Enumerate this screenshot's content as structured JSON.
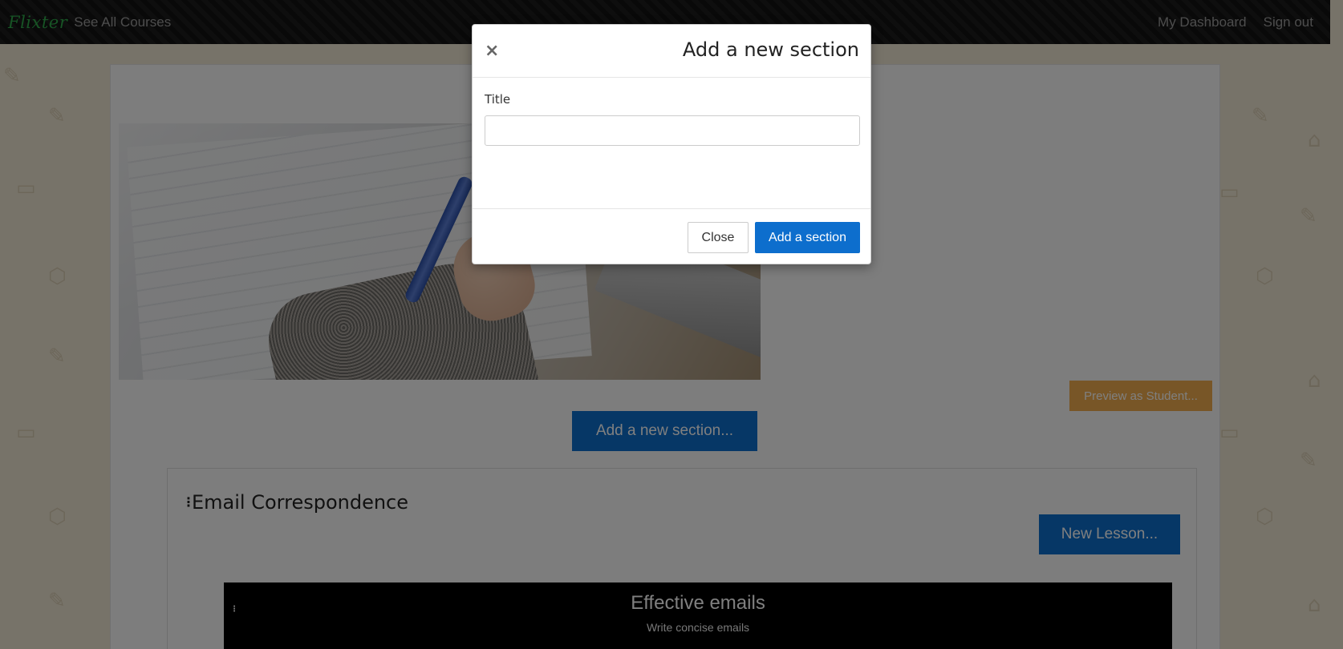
{
  "navbar": {
    "brand": "Flixter",
    "see_all_courses": "See All Courses",
    "my_dashboard": "My Dashboard",
    "sign_out": "Sign out"
  },
  "page": {
    "preview_button": "Preview as Student...",
    "add_section_button": "Add a new section...",
    "section": {
      "title": "Email Correspondence",
      "new_lesson_button": "New Lesson...",
      "lesson": {
        "title": "Effective emails",
        "subtitle": "Write concise emails"
      }
    }
  },
  "modal": {
    "close_icon": "×",
    "title": "Add a new section",
    "field_label": "Title",
    "title_value": "",
    "close_button": "Close",
    "submit_button": "Add a section"
  },
  "colors": {
    "primary": "#0d6ecd",
    "warning": "#f0ad4e",
    "brand": "#2ea84a",
    "navbar_bg": "#141414",
    "page_bg": "#efe6d3"
  }
}
